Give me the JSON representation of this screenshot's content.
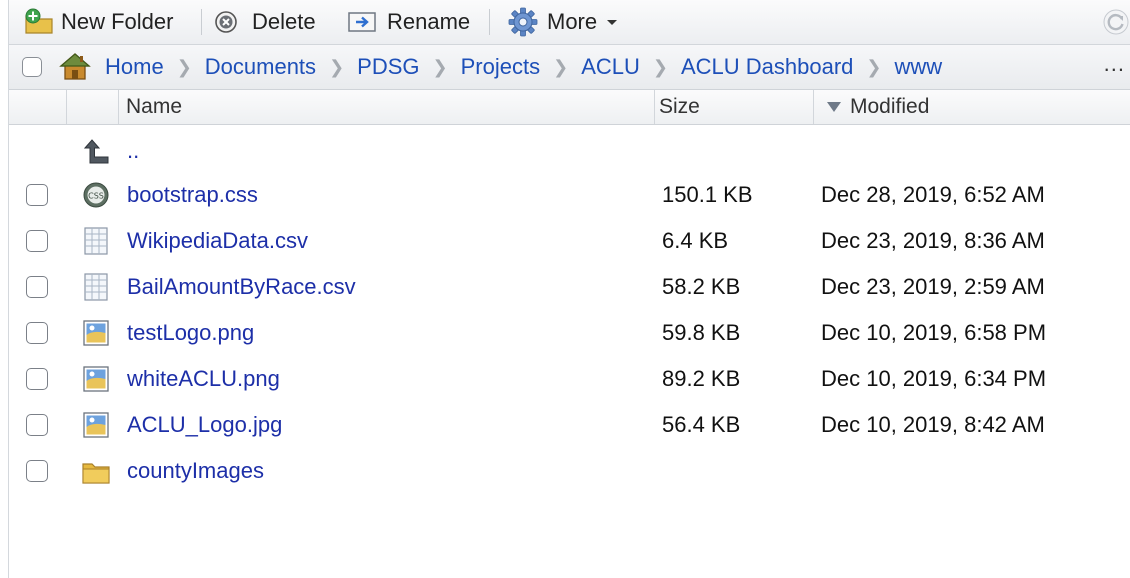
{
  "toolbar": {
    "new_folder": "New Folder",
    "delete": "Delete",
    "rename": "Rename",
    "more": "More"
  },
  "breadcrumb": {
    "items": [
      "Home",
      "Documents",
      "PDSG",
      "Projects",
      "ACLU",
      "ACLU Dashboard",
      "www"
    ],
    "overflow": "..."
  },
  "columns": {
    "name": "Name",
    "size": "Size",
    "modified": "Modified"
  },
  "parent_link": "..",
  "files": [
    {
      "name": "bootstrap.css",
      "size": "150.1 KB",
      "modified": "Dec 28, 2019, 6:52 AM",
      "icon": "css-file-icon"
    },
    {
      "name": "WikipediaData.csv",
      "size": "6.4 KB",
      "modified": "Dec 23, 2019, 8:36 AM",
      "icon": "csv-file-icon"
    },
    {
      "name": "BailAmountByRace.csv",
      "size": "58.2 KB",
      "modified": "Dec 23, 2019, 2:59 AM",
      "icon": "csv-file-icon"
    },
    {
      "name": "testLogo.png",
      "size": "59.8 KB",
      "modified": "Dec 10, 2019, 6:58 PM",
      "icon": "image-file-icon"
    },
    {
      "name": "whiteACLU.png",
      "size": "89.2 KB",
      "modified": "Dec 10, 2019, 6:34 PM",
      "icon": "image-file-icon"
    },
    {
      "name": "ACLU_Logo.jpg",
      "size": "56.4 KB",
      "modified": "Dec 10, 2019, 8:42 AM",
      "icon": "image-file-icon"
    },
    {
      "name": "countyImages",
      "size": "",
      "modified": "",
      "icon": "folder-icon"
    }
  ],
  "colors": {
    "link": "#1d2fa8",
    "breadcrumb_link": "#1d4fb8",
    "toolbar_bg": "#eceef1"
  }
}
